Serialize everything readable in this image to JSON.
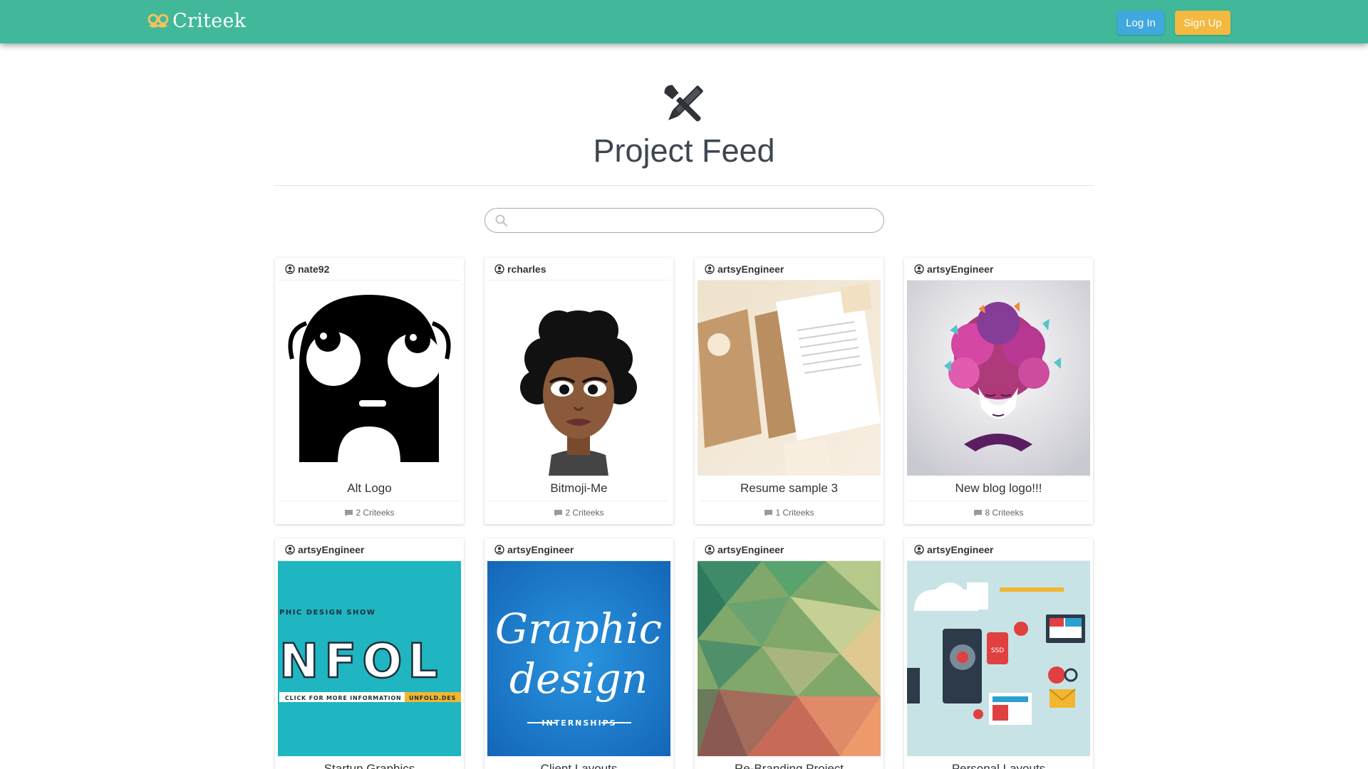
{
  "app": {
    "brand": "Criteek",
    "login_label": "Log In",
    "signup_label": "Sign Up",
    "colors": {
      "navbar": "#41b899",
      "login": "#3fa8de",
      "signup": "#f4b940",
      "brand_icon": "#f4c25a"
    }
  },
  "header": {
    "icon": "pencil-brush-crossed-icon",
    "title": "Project Feed"
  },
  "search": {
    "placeholder": "",
    "value": "",
    "icon": "search-icon"
  },
  "projects": [
    {
      "user": "nate92",
      "title": "Alt Logo",
      "comments": "2 Criteeks",
      "image": "black-monster-logo"
    },
    {
      "user": "rcharles",
      "title": "Bitmoji-Me",
      "comments": "2 Criteeks",
      "image": "bitmoji-avatar"
    },
    {
      "user": "artsyEngineer",
      "title": "Resume sample 3",
      "comments": "1 Criteeks",
      "image": "stationery-mockup"
    },
    {
      "user": "artsyEngineer",
      "title": "New blog logo!!!",
      "comments": "8 Criteeks",
      "image": "butterfly-hair-woman"
    },
    {
      "user": "artsyEngineer",
      "title": "Startup Graphics",
      "comments": "",
      "image": "unfold-poster",
      "image_text": {
        "top": "PHIC DESIGN SHOW",
        "main": "NFOL",
        "bottom_left": "CLICK FOR MORE INFORMATION",
        "bottom_right": "UNFOLD.DES"
      }
    },
    {
      "user": "artsyEngineer",
      "title": "Client Layouts",
      "comments": "",
      "image": "graphic-design-lettering",
      "image_text": {
        "line1": "Graphic",
        "line2": "design",
        "line3": "INTERNSHIPS"
      }
    },
    {
      "user": "artsyEngineer",
      "title": "Re-Branding Project",
      "comments": "",
      "image": "low-poly-gradient"
    },
    {
      "user": "artsyEngineer",
      "title": "Personal Layouts",
      "comments": "",
      "image": "flat-tech-icons",
      "image_text": {
        "badge": "SSD"
      }
    }
  ]
}
